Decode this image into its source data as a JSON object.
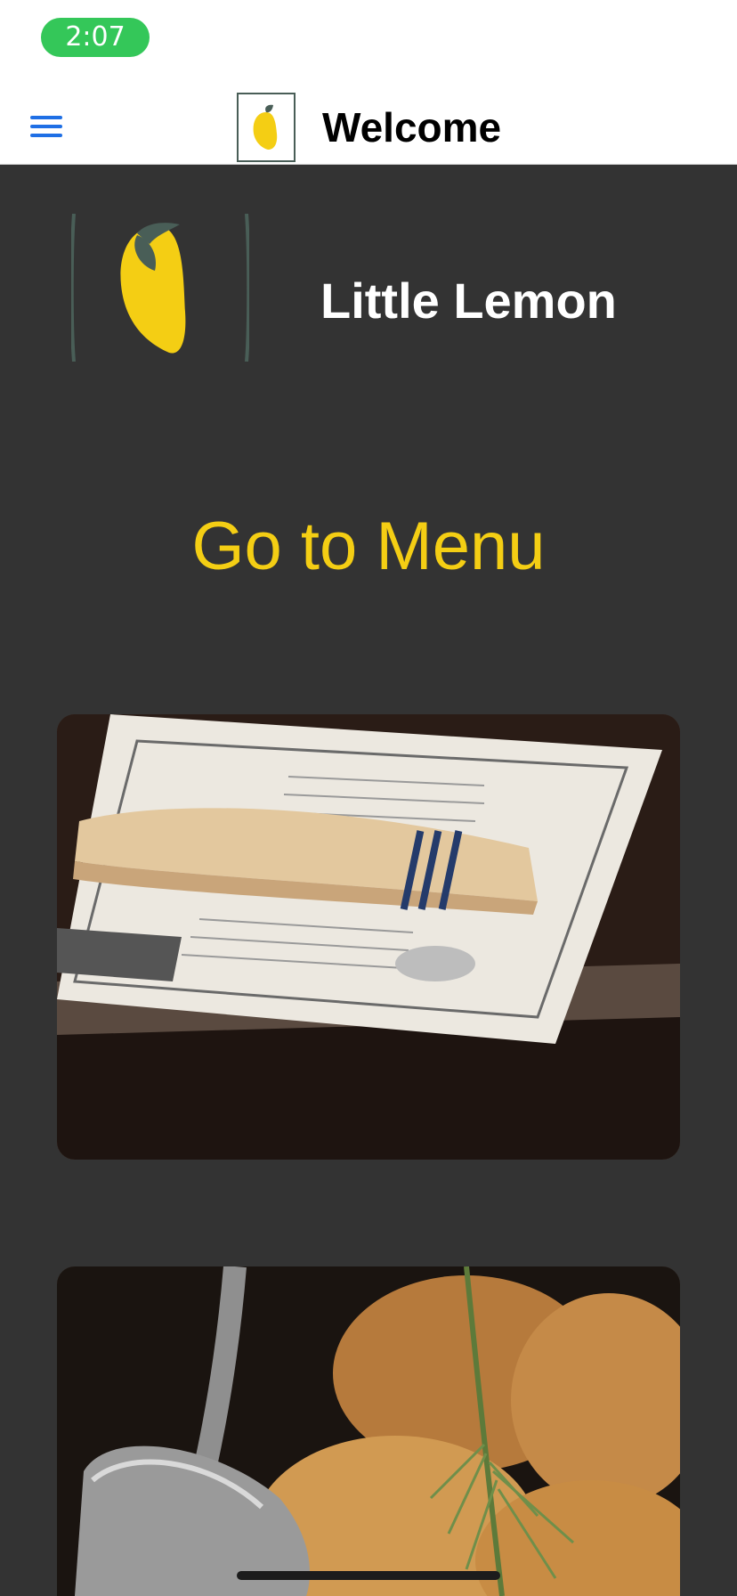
{
  "status_bar": {
    "time": "2:07"
  },
  "nav": {
    "menu_icon": "hamburger-menu-icon",
    "logo_icon": "little-lemon-logo-icon",
    "title": "Welcome"
  },
  "hero": {
    "logo_icon": "little-lemon-logo-icon",
    "title": "Little Lemon"
  },
  "menu_link": {
    "label": "Go to Menu"
  },
  "photos": [
    {
      "subject": "restaurant-table-menu-photo"
    },
    {
      "subject": "roasted-potatoes-food-photo"
    }
  ],
  "colors": {
    "background": "#333333",
    "accent_yellow": "#f4ce14",
    "nav_blue": "#1f6fe5",
    "status_green": "#34c759",
    "logo_green": "#495e57"
  }
}
